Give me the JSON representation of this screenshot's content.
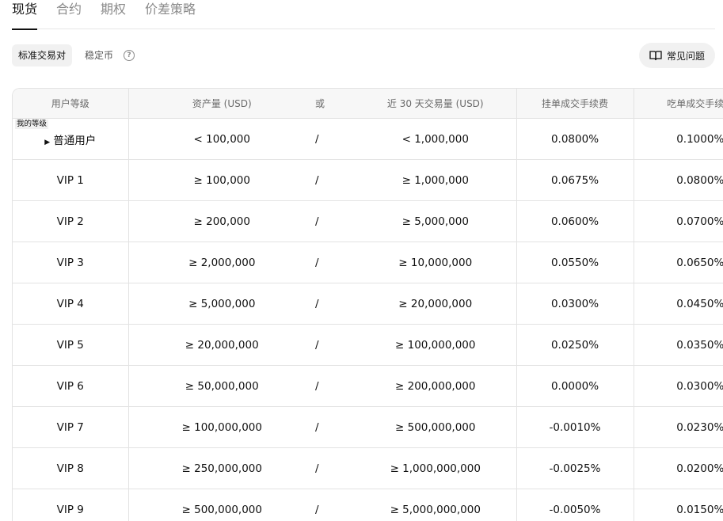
{
  "tabs": [
    "现货",
    "合约",
    "期权",
    "价差策略"
  ],
  "sub": {
    "standard_pairs": "标准交易对",
    "stablecoin": "稳定币",
    "faq": "常见问题"
  },
  "table": {
    "headers": {
      "level": "用户等级",
      "assets": "资产量 (USD)",
      "or": "或",
      "volume": "近 30 天交易量 (USD)",
      "maker": "挂单成交手续费",
      "taker": "吃单成交手续费"
    },
    "my_level_tag": "我的等级",
    "rows": [
      {
        "level": "普通用户",
        "assets": "< 100,000",
        "or": "/",
        "volume": "< 1,000,000",
        "maker": "0.0800%",
        "taker": "0.1000%"
      },
      {
        "level": "VIP 1",
        "assets": "≥ 100,000",
        "or": "/",
        "volume": "≥ 1,000,000",
        "maker": "0.0675%",
        "taker": "0.0800%"
      },
      {
        "level": "VIP 2",
        "assets": "≥ 200,000",
        "or": "/",
        "volume": "≥ 5,000,000",
        "maker": "0.0600%",
        "taker": "0.0700%"
      },
      {
        "level": "VIP 3",
        "assets": "≥ 2,000,000",
        "or": "/",
        "volume": "≥ 10,000,000",
        "maker": "0.0550%",
        "taker": "0.0650%"
      },
      {
        "level": "VIP 4",
        "assets": "≥ 5,000,000",
        "or": "/",
        "volume": "≥ 20,000,000",
        "maker": "0.0300%",
        "taker": "0.0450%"
      },
      {
        "level": "VIP 5",
        "assets": "≥ 20,000,000",
        "or": "/",
        "volume": "≥ 100,000,000",
        "maker": "0.0250%",
        "taker": "0.0350%"
      },
      {
        "level": "VIP 6",
        "assets": "≥ 50,000,000",
        "or": "/",
        "volume": "≥ 200,000,000",
        "maker": "0.0000%",
        "taker": "0.0300%"
      },
      {
        "level": "VIP 7",
        "assets": "≥ 100,000,000",
        "or": "/",
        "volume": "≥ 500,000,000",
        "maker": "-0.0010%",
        "taker": "0.0230%"
      },
      {
        "level": "VIP 8",
        "assets": "≥ 250,000,000",
        "or": "/",
        "volume": "≥ 1,000,000,000",
        "maker": "-0.0025%",
        "taker": "0.0200%"
      },
      {
        "level": "VIP 9",
        "assets": "≥ 500,000,000",
        "or": "/",
        "volume": "≥ 5,000,000,000",
        "maker": "-0.0050%",
        "taker": "0.0150%"
      }
    ]
  }
}
